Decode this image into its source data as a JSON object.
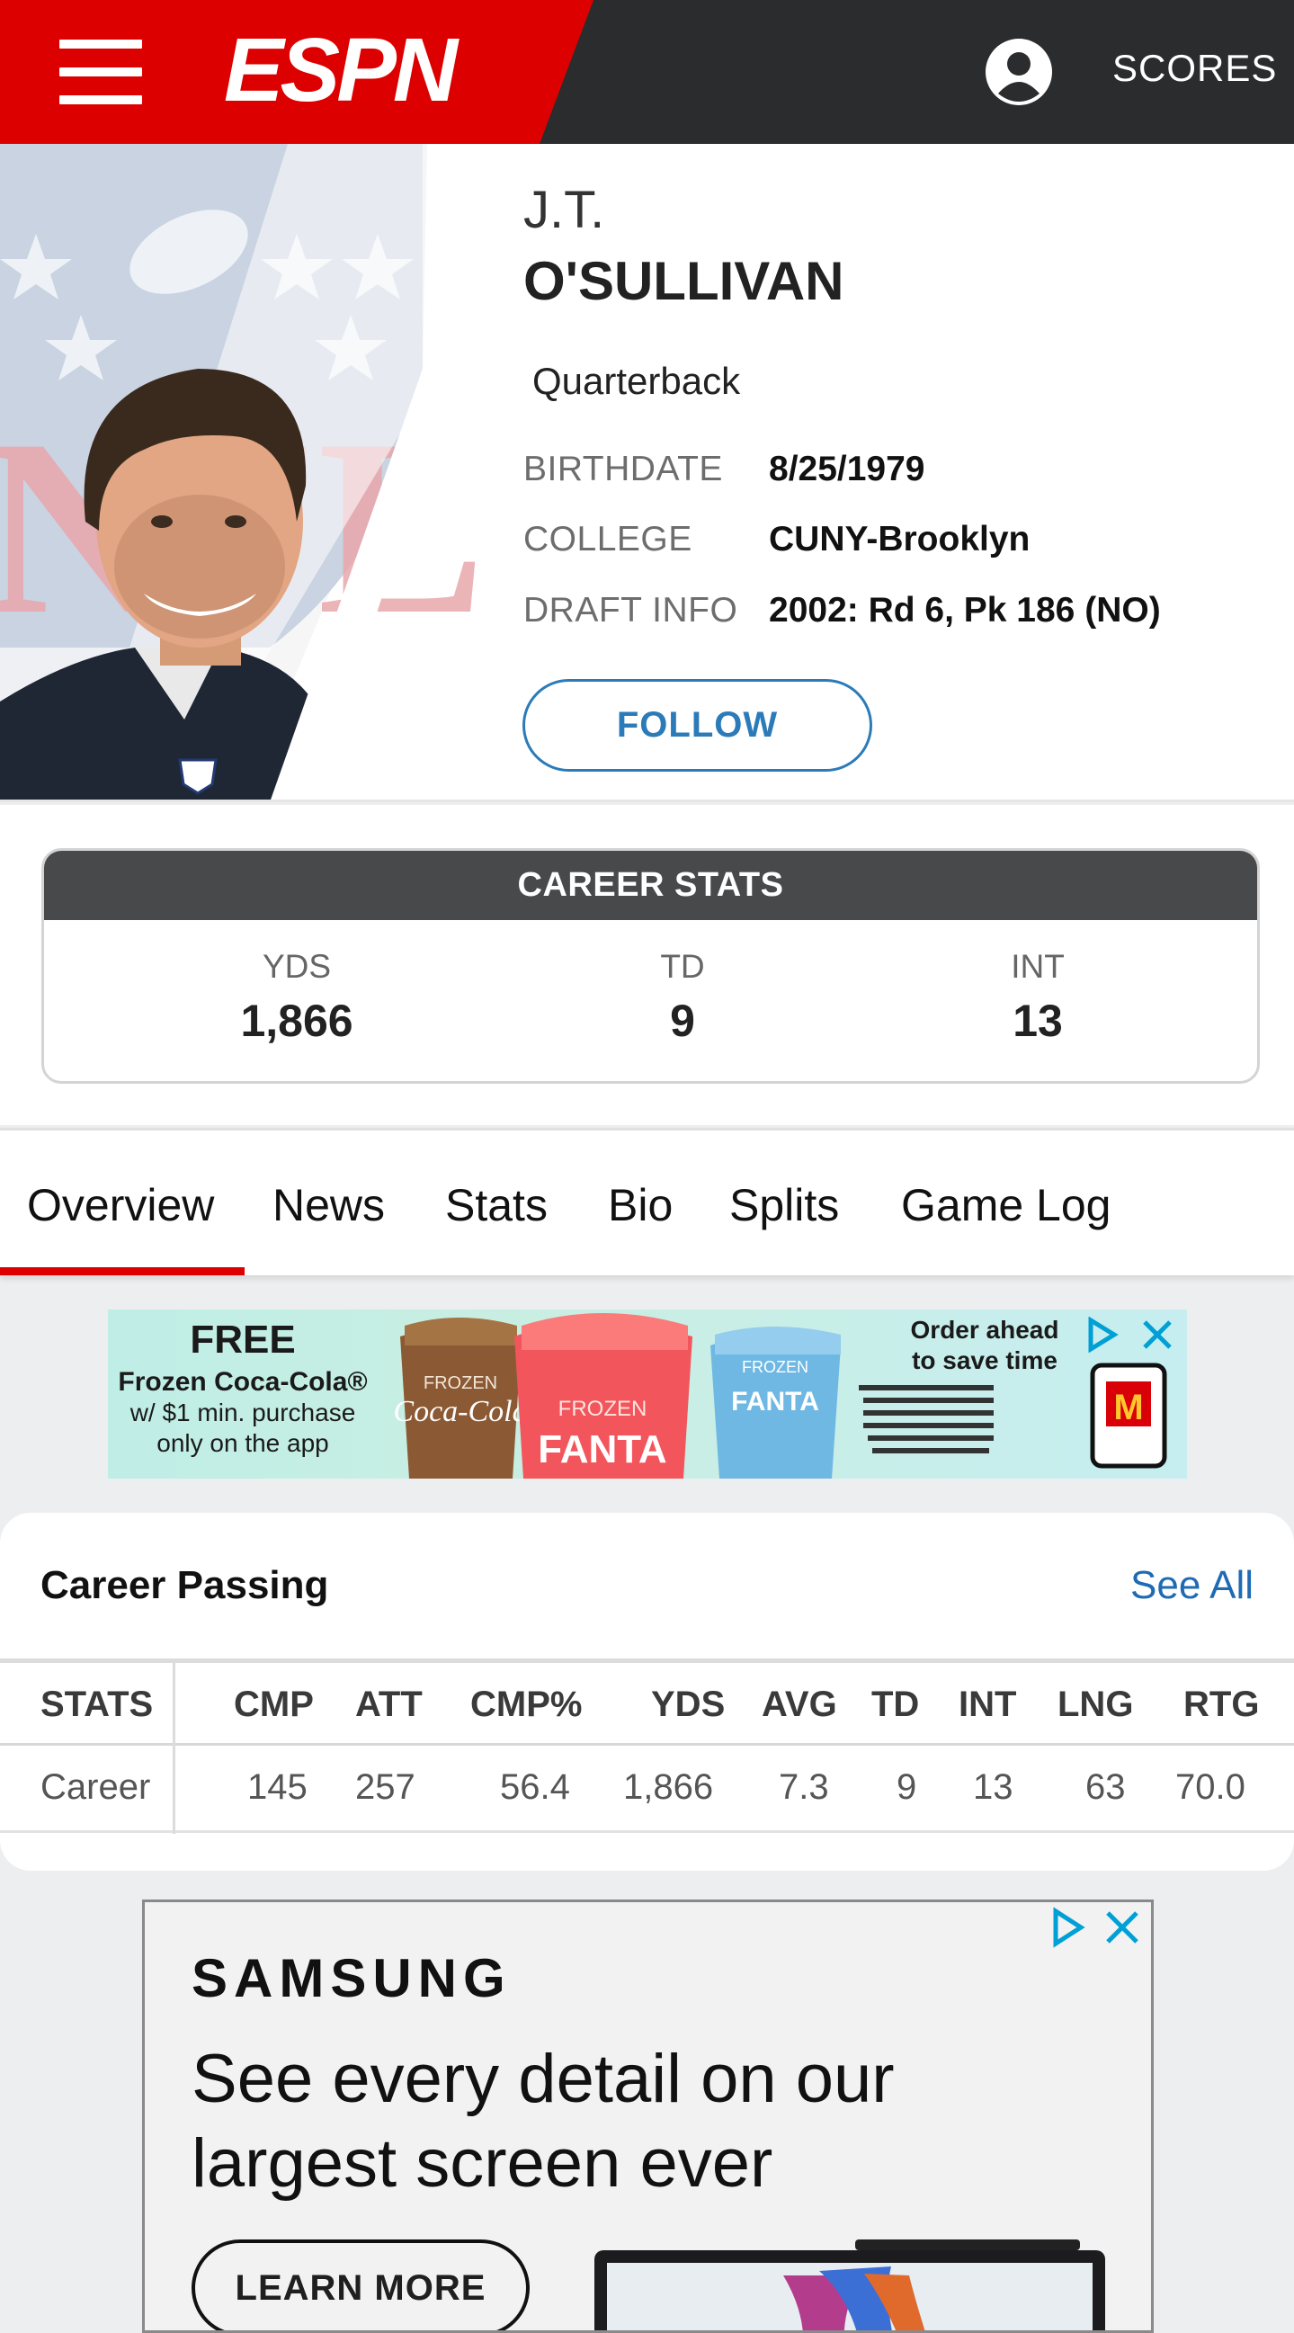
{
  "header": {
    "brand": "ESPN",
    "scores_label": "SCORES"
  },
  "player": {
    "first_name": "J.T.",
    "last_name": "O'SULLIVAN",
    "position": "Quarterback",
    "bio": [
      {
        "label": "BIRTHDATE",
        "value": "8/25/1979"
      },
      {
        "label": "COLLEGE",
        "value": "CUNY-Brooklyn"
      },
      {
        "label": "DRAFT INFO",
        "value": "2002: Rd 6, Pk 186 (NO)"
      }
    ],
    "follow_label": "FOLLOW"
  },
  "career_stats": {
    "title": "CAREER STATS",
    "items": [
      {
        "label": "YDS",
        "value": "1,866"
      },
      {
        "label": "TD",
        "value": "9"
      },
      {
        "label": "INT",
        "value": "13"
      }
    ]
  },
  "tabs": [
    {
      "label": "Overview",
      "active": true
    },
    {
      "label": "News"
    },
    {
      "label": "Stats"
    },
    {
      "label": "Bio"
    },
    {
      "label": "Splits"
    },
    {
      "label": "Game Log"
    }
  ],
  "ad_top": {
    "free": "FREE",
    "line1": "Frozen Coca-Cola®",
    "line2": "w/ $1 min. purchase",
    "line3": "only on the app",
    "cup1": "Coca-Cola",
    "cup2": "FANTA",
    "cup3": "FANTA",
    "frozen": "FROZEN",
    "order1": "Order ahead",
    "order2": "to save time",
    "mcd": "M"
  },
  "career_passing": {
    "title": "Career Passing",
    "see_all": "See All",
    "columns": [
      "STATS",
      "CMP",
      "ATT",
      "CMP%",
      "YDS",
      "AVG",
      "TD",
      "INT",
      "LNG",
      "RTG"
    ],
    "rows": [
      [
        "Career",
        "145",
        "257",
        "56.4",
        "1,866",
        "7.3",
        "9",
        "13",
        "63",
        "70.0"
      ]
    ]
  },
  "ad_bottom": {
    "brand": "SAMSUNG",
    "headline": "See every detail on our largest screen ever",
    "cta": "LEARN MORE"
  },
  "colors": {
    "espn_red": "#dd0000",
    "header_dark": "#2b2c2d",
    "link_blue": "#1f6bb3"
  }
}
